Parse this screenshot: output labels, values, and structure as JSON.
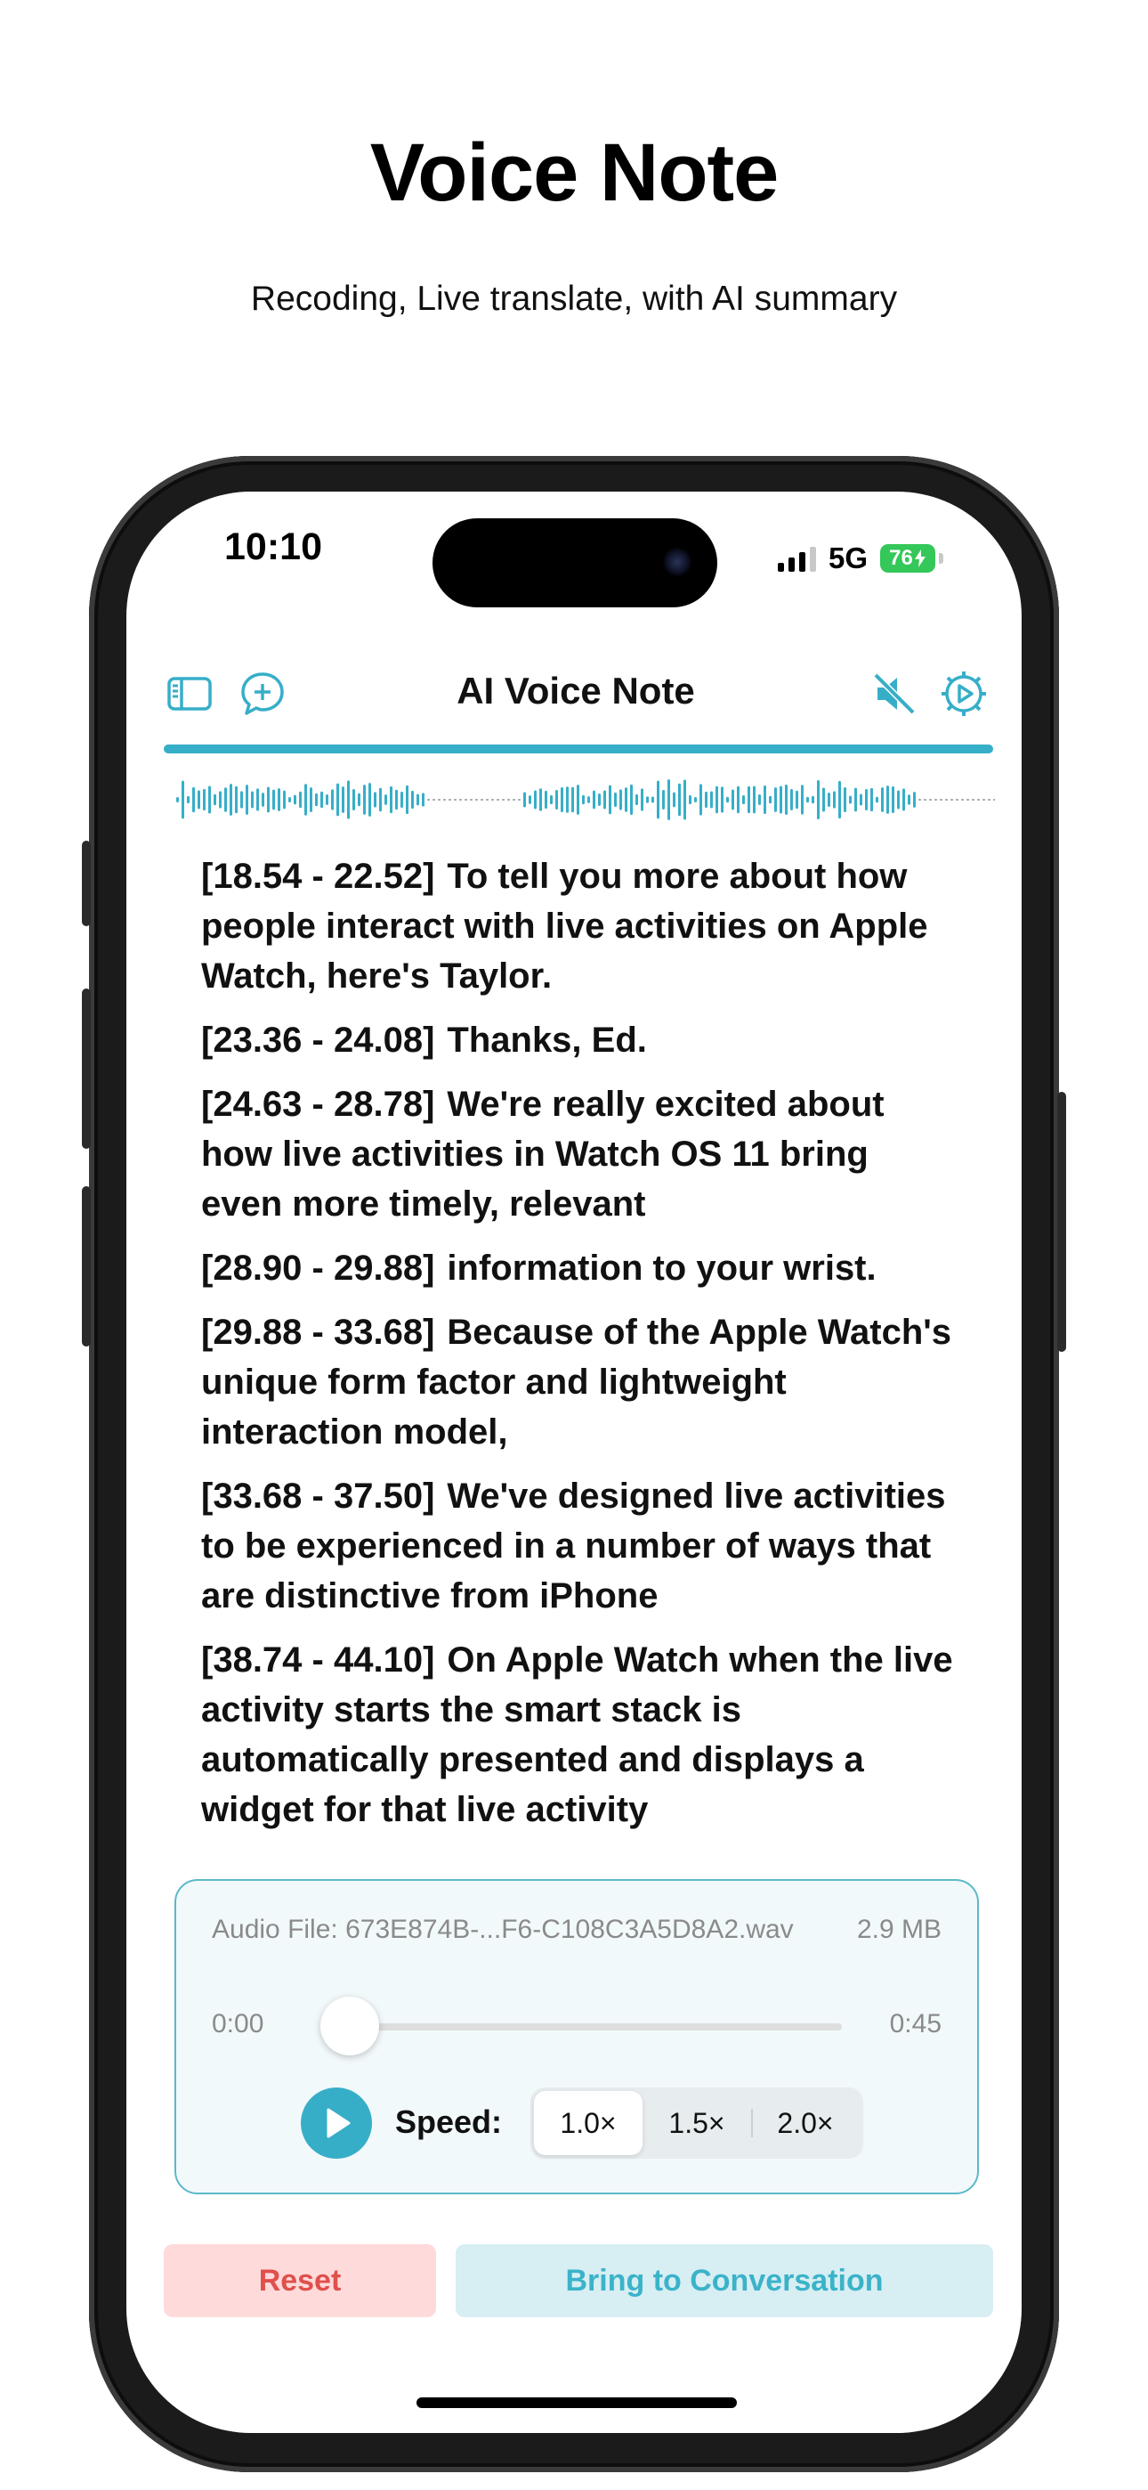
{
  "promo": {
    "title": "Voice Note",
    "subtitle": "Recoding, Live translate, with AI summary"
  },
  "status_bar": {
    "time": "10:10",
    "network": "5G",
    "battery": "76"
  },
  "header": {
    "title": "AI Voice Note",
    "icons": [
      "sidebar-icon",
      "chat-add-icon",
      "speaker-muted-icon",
      "settings-icon"
    ]
  },
  "recording_progress": 1.0,
  "transcript": [
    {
      "ts": "[18.54 - 22.52]",
      "text": "To tell you more about how people interact with live activities on Apple Watch, here's Taylor."
    },
    {
      "ts": "[23.36 - 24.08]",
      "text": "Thanks, Ed."
    },
    {
      "ts": "[24.63 - 28.78]",
      "text": "We're really excited about how live activities in Watch OS 11 bring even more timely, relevant"
    },
    {
      "ts": "[28.90 - 29.88]",
      "text": "information to your wrist."
    },
    {
      "ts": "[29.88 - 33.68]",
      "text": "Because of the Apple Watch's unique form factor and lightweight interaction model,"
    },
    {
      "ts": "[33.68 - 37.50]",
      "text": "We've designed live activities to be experienced in a number of ways that are distinctive from iPhone"
    },
    {
      "ts": "[38.74 - 44.10]",
      "text": "On Apple Watch when the live activity starts the smart stack is automatically presented and displays a widget for that live activity"
    }
  ],
  "audio_player": {
    "file_label": "Audio File: 673E874B-...F6-C108C3A5D8A2.wav",
    "file_size": "2.9 MB",
    "current_time": "0:00",
    "duration": "0:45",
    "progress": 0.0,
    "speed_label": "Speed:",
    "speed_options": [
      "1.0×",
      "1.5×",
      "2.0×"
    ],
    "selected_speed": "1.0×"
  },
  "actions": {
    "reset_label": "Reset",
    "bring_label": "Bring to Conversation"
  },
  "colors": {
    "accent": "#37aec8",
    "reset_bg": "#ffdada",
    "reset_text": "#e0504c",
    "bring_bg": "#d7eef3",
    "battery": "#34c759"
  }
}
